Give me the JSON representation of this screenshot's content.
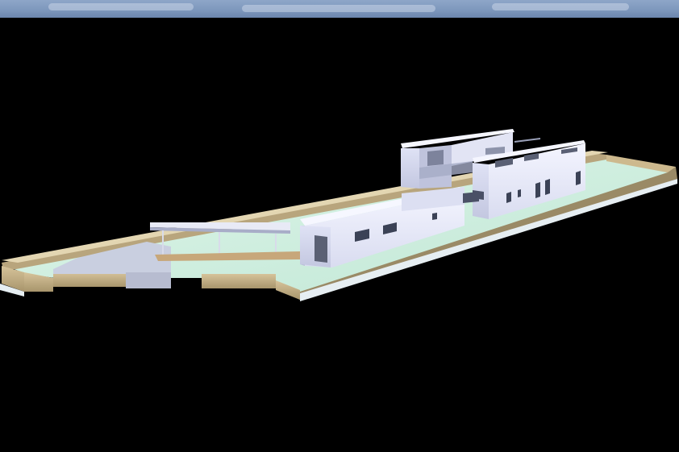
{
  "scene": {
    "subject": "3d-render-modern-house-on-walled-plot",
    "background_color": "#000000",
    "sky_color": "#7f99be",
    "lawn_color": "#cfeee0",
    "wall_color": "#c9b58b",
    "building_color": "#eef0fa",
    "terrace_color": "#c7a77a"
  }
}
